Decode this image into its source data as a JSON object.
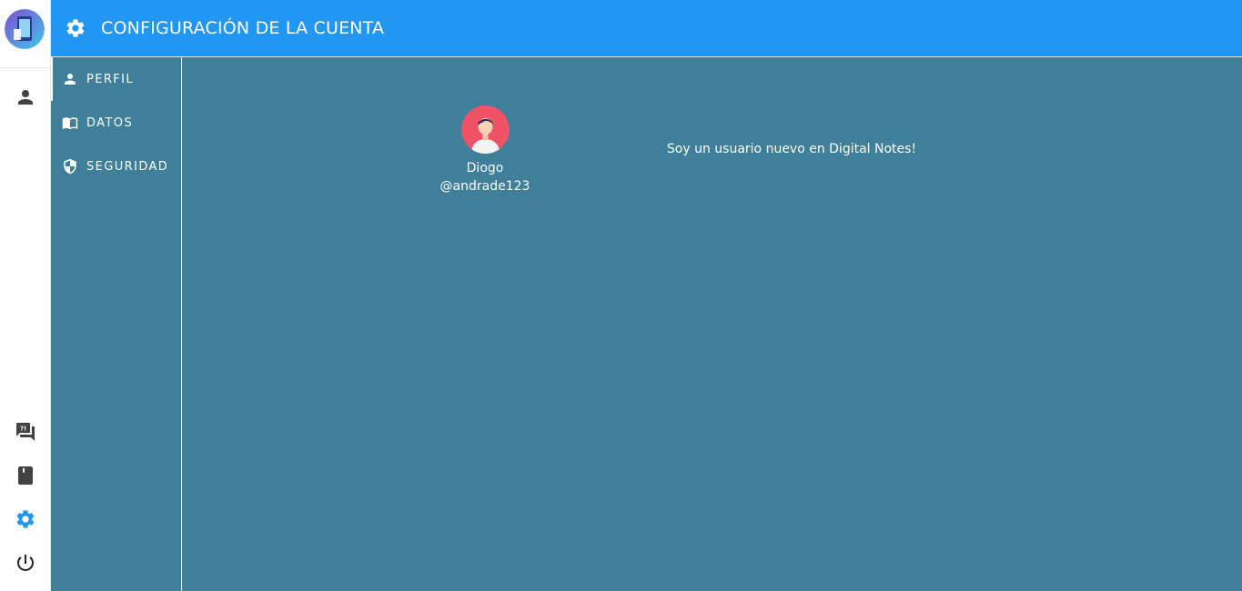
{
  "app": {
    "colors": {
      "header": "#2196f3",
      "panel": "#3f7f99",
      "active_icon": "#2196f3"
    }
  },
  "rail": {
    "logo_icon": "app-logo-icon",
    "top_items": [
      {
        "icon": "person-icon"
      }
    ],
    "bottom_items": [
      {
        "icon": "question-answer-icon"
      },
      {
        "icon": "book-icon"
      },
      {
        "icon": "gear-icon",
        "active": true
      },
      {
        "icon": "power-icon"
      }
    ]
  },
  "header": {
    "icon": "gear-icon",
    "title": "CONFIGURACIÓN DE LA CUENTA"
  },
  "menu": {
    "items": [
      {
        "label": "PERFIL",
        "icon": "person-icon",
        "active": true
      },
      {
        "label": "DATOS",
        "icon": "book-open-icon"
      },
      {
        "label": "SEGURIDAD",
        "icon": "shield-icon"
      }
    ]
  },
  "profile": {
    "name": "Diogo",
    "handle": "@andrade123",
    "bio": "Soy un usuario nuevo en Digital Notes!"
  }
}
